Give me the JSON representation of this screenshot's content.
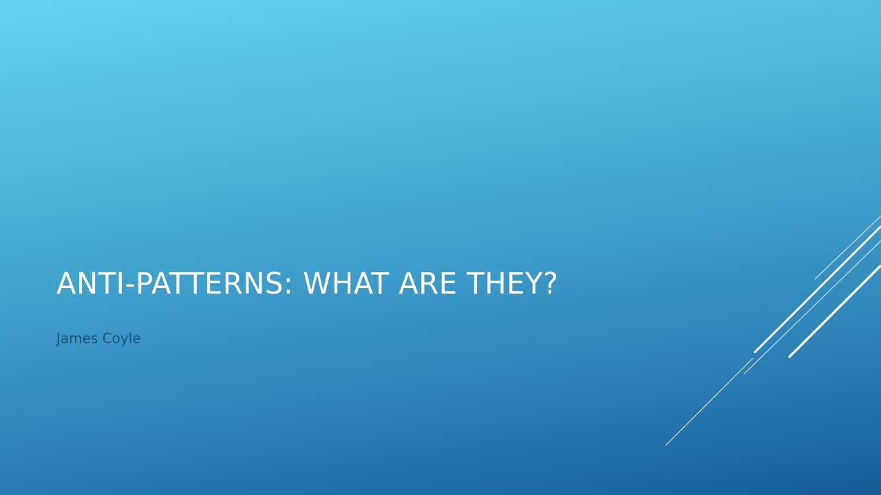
{
  "slide": {
    "title": "Anti-Patterns: What Are They?",
    "subtitle": "James Coyle"
  },
  "theme": {
    "title_color": "#ffffff",
    "subtitle_color": "#1d4f7a",
    "line_color": "#ffffff",
    "background_top": "#63d3ef",
    "background_bottom": "#155c96"
  }
}
